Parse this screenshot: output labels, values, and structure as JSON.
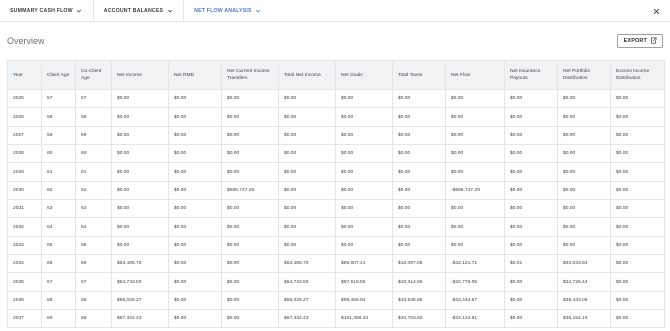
{
  "tabs": [
    {
      "label": "SUMMARY CASH FLOW",
      "active": false
    },
    {
      "label": "ACCOUNT BALANCES",
      "active": false
    },
    {
      "label": "NET FLOW ANALYSIS",
      "active": true
    }
  ],
  "page_title": "Overview",
  "export_label": "EXPORT",
  "colors": {
    "accent": "#4a78c9",
    "header_bg": "#f1f2f4",
    "border": "#e3e5e9"
  },
  "icons": {
    "close": "close-icon",
    "export": "export-icon",
    "chevron": "chevron-down-icon"
  },
  "table": {
    "columns": [
      "Year",
      "Client Age",
      "Co-Client Age",
      "Net Income",
      "Net RMD",
      "Net Current Income Transfers",
      "Total Net Income",
      "Net Goals",
      "Total Taxes",
      "Net Flow",
      "Net Insurance Payouts",
      "Net Portfolio Distribution",
      "Excess Income Distribution"
    ],
    "rows": [
      [
        "2025",
        "57",
        "57",
        "$0.00",
        "$0.00",
        "$0.00",
        "$0.00",
        "$0.00",
        "$0.00",
        "$0.00",
        "$0.00",
        "$0.00",
        "$0.00"
      ],
      [
        "2026",
        "58",
        "58",
        "$0.00",
        "$0.00",
        "$0.00",
        "$0.00",
        "$0.00",
        "$0.00",
        "$0.00",
        "$0.00",
        "$0.00",
        "$0.00"
      ],
      [
        "2027",
        "59",
        "59",
        "$0.00",
        "$0.00",
        "$0.00",
        "$0.00",
        "$0.00",
        "$0.00",
        "$0.00",
        "$0.00",
        "$0.00",
        "$0.00"
      ],
      [
        "2028",
        "60",
        "60",
        "$0.00",
        "$0.00",
        "$0.00",
        "$0.00",
        "$0.00",
        "$0.00",
        "$0.00",
        "$0.00",
        "$0.00",
        "$0.00"
      ],
      [
        "2029",
        "61",
        "61",
        "$0.00",
        "$0.00",
        "$0.00",
        "$0.00",
        "$0.00",
        "$0.00",
        "$0.00",
        "$0.00",
        "$0.00",
        "$0.00"
      ],
      [
        "2030",
        "62",
        "62",
        "$0.00",
        "$0.00",
        "$565,747.29",
        "$0.00",
        "$0.00",
        "$0.00",
        "-$565,747.29",
        "$0.00",
        "$0.00",
        "$0.00"
      ],
      [
        "2031",
        "63",
        "63",
        "$0.00",
        "$0.00",
        "$0.00",
        "$0.00",
        "$0.00",
        "$0.00",
        "$0.00",
        "$0.00",
        "$0.00",
        "$0.00"
      ],
      [
        "2032",
        "64",
        "64",
        "$0.00",
        "$0.00",
        "$0.00",
        "$0.00",
        "$0.00",
        "$0.00",
        "$0.00",
        "$0.00",
        "$0.00",
        "$0.00"
      ],
      [
        "2033",
        "65",
        "65",
        "$0.00",
        "$0.00",
        "$0.00",
        "$0.00",
        "$0.00",
        "$0.00",
        "$0.00",
        "$0.00",
        "$0.00",
        "$0.00"
      ],
      [
        "2034",
        "66",
        "66",
        "$63,485.70",
        "$0.00",
        "$0.00",
        "$63,485.70",
        "$95,607.41",
        "$10,097.09",
        "-$32,121.71",
        "$0.01",
        "$34,033.84",
        "$0.00"
      ],
      [
        "2035",
        "67",
        "67",
        "$64,743.50",
        "$0.00",
        "$0.00",
        "$64,743.50",
        "$97,519.55",
        "$10,314.66",
        "-$32,776.05",
        "$0.00",
        "$34,726.44",
        "$0.00"
      ],
      [
        "2036",
        "68",
        "68",
        "$66,026.27",
        "$0.00",
        "$0.00",
        "$66,026.27",
        "$99,469.94",
        "$10,536.88",
        "-$33,443.67",
        "$0.00",
        "$35,433.08",
        "$0.00"
      ],
      [
        "2037",
        "69",
        "69",
        "$67,334.43",
        "$0.00",
        "$0.00",
        "$67,334.43",
        "$101,459.34",
        "$10,763.82",
        "-$34,124.91",
        "$0.00",
        "$36,154.10",
        "$0.00"
      ]
    ]
  }
}
